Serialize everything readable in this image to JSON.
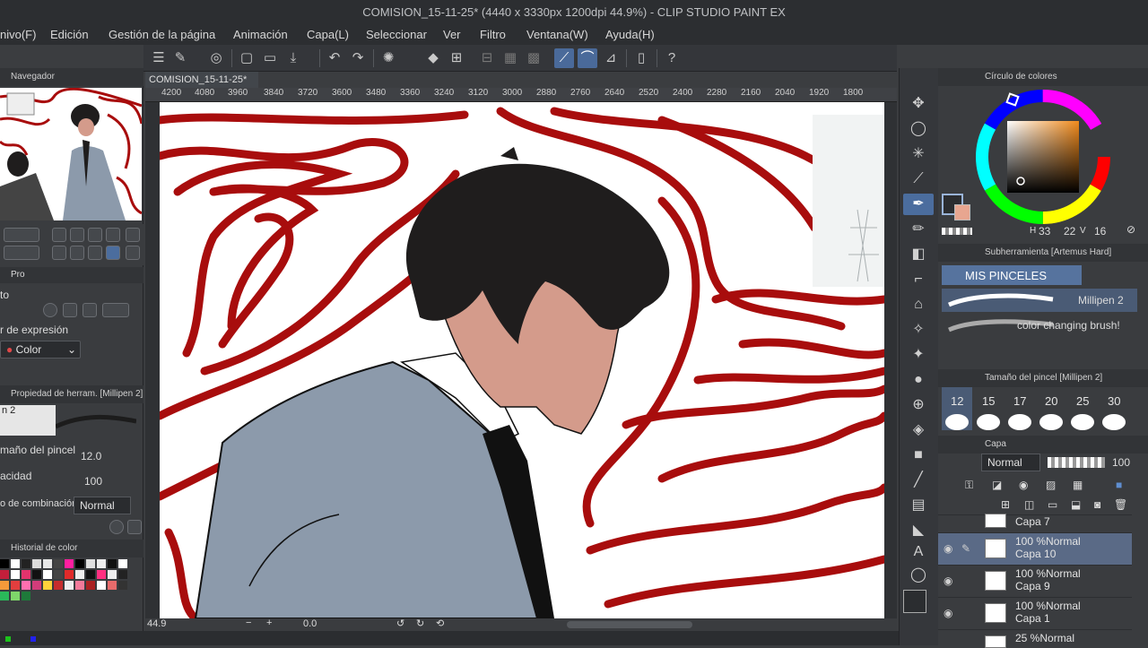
{
  "window": {
    "title": "COMISION_15-11-25* (4440 x 3330px 1200dpi 44.9%) - CLIP STUDIO PAINT EX"
  },
  "menu": [
    {
      "label": "nivo(F)"
    },
    {
      "label": "Edición"
    },
    {
      "label": "Gestión de la página"
    },
    {
      "label": "Animación"
    },
    {
      "label": "Capa(L)"
    },
    {
      "label": "Seleccionar"
    },
    {
      "label": "Ver"
    },
    {
      "label": "Filtro"
    },
    {
      "label": "Ventana(W)"
    },
    {
      "label": "Ayuda(H)"
    }
  ],
  "navigator": {
    "title": "Navegador"
  },
  "left_tabs": {
    "tab1": "Pro"
  },
  "tool_settings": {
    "section_label": "to",
    "expression_label": "r de expresión",
    "expression_value": "Color"
  },
  "tool_property": {
    "title": "Propiedad de herram. [Millipen 2]",
    "preview_label": "n 2",
    "brush_size_label": "maño del pincel",
    "brush_size_value": "12.0",
    "opacity_label": "acidad",
    "opacity_value": "100",
    "blend_label": "o de combinación",
    "blend_value": "Normal"
  },
  "color_history": {
    "title": "Historial de color"
  },
  "canvas": {
    "tab_label": "COMISION_15-11-25*",
    "ruler_ticks": [
      "4200",
      "4080",
      "3960",
      "3840",
      "3720",
      "3600",
      "3480",
      "3360",
      "3240",
      "3120",
      "3000",
      "2880",
      "2760",
      "2640",
      "2520",
      "2400",
      "2280",
      "2160",
      "2040",
      "1920",
      "1800"
    ],
    "zoom": "44.9",
    "rotation": "0.0"
  },
  "color_wheel": {
    "title": "Círculo de colores",
    "h": "33",
    "s": "22",
    "v": "16",
    "hue_label": "H",
    "v_label": "V",
    "main_color": "#2b2d30",
    "sub_color": "#e8a690"
  },
  "subtool": {
    "title": "Subherramienta [Artemus Hard]",
    "group": "MIS PINCELES",
    "brushes": [
      {
        "name": "Millipen 2"
      },
      {
        "name": "color changing brush!"
      }
    ]
  },
  "brush_size": {
    "title": "Tamaño del pincel [Millipen 2]",
    "sizes": [
      "12",
      "15",
      "17",
      "20",
      "25",
      "30"
    ]
  },
  "layers": {
    "title": "Capa",
    "blend_mode": "Normal",
    "opacity": "100",
    "items": [
      {
        "mode": "",
        "name": "Capa 7"
      },
      {
        "mode": "100 %Normal",
        "name": "Capa 10"
      },
      {
        "mode": "100 %Normal",
        "name": "Capa 9"
      },
      {
        "mode": "100 %Normal",
        "name": "Capa 1"
      },
      {
        "mode": "25 %Normal",
        "name": ""
      }
    ]
  },
  "colors": {
    "accent": "#4b6d9e",
    "canvas_lines": "#a80d0d",
    "hair": "#1f1d1d",
    "suit": "#8c9aab",
    "skin": "#d49b8b"
  }
}
